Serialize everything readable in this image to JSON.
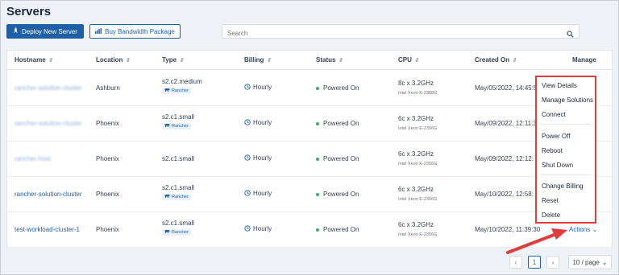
{
  "page": {
    "title": "Servers"
  },
  "toolbar": {
    "deploy_label": "Deploy New Server",
    "bandwidth_label": "Buy Bandwidth Package",
    "search_placeholder": "Search"
  },
  "columns": {
    "hostname": "Hostname",
    "location": "Location",
    "type": "Type",
    "billing": "Billing",
    "status": "Status",
    "cpu": "CPU",
    "created": "Created On",
    "manage": "Manage"
  },
  "rows": [
    {
      "hostname": "rancher-solution-cluster",
      "hostname_blurred": true,
      "location": "Ashburn",
      "type": "s2.c2.medium",
      "tag": "Rancher",
      "billing": "Hourly",
      "status": "Powered On",
      "cpu": "8c x 3.2GHz",
      "cpu_sub": "Intel Xeon E-2388G",
      "created": "May/05/2022, 14:45:5"
    },
    {
      "hostname": "rancher-solution-cluster",
      "hostname_blurred": true,
      "location": "Phoenix",
      "type": "s2.c1.small",
      "tag": "Rancher",
      "billing": "Hourly",
      "status": "Powered On",
      "cpu": "6c x 3.2GHz",
      "cpu_sub": "Intel Xeon E-2356G",
      "created": "May/09/2022, 12:11:3"
    },
    {
      "hostname": "rancher-host",
      "hostname_blurred": true,
      "location": "Phoenix",
      "type": "s2.c1.small",
      "tag": "",
      "billing": "Hourly",
      "status": "Powered On",
      "cpu": "6c x 3.2GHz",
      "cpu_sub": "Intel Xeon E-2356G",
      "created": "May/09/2022, 12:12:"
    },
    {
      "hostname": "rancher-solution-cluster",
      "hostname_blurred": false,
      "location": "Phoenix",
      "type": "s2.c1.small",
      "tag": "Rancher",
      "billing": "Hourly",
      "status": "Powered On",
      "cpu": "6c x 3.2GHz",
      "cpu_sub": "Intel Xeon E-2356G",
      "created": "May/10/2022, 12:58:"
    },
    {
      "hostname": "test-workload-cluster-1",
      "hostname_blurred": false,
      "location": "Phoenix",
      "type": "s2.c1.small",
      "tag": "Rancher",
      "billing": "Hourly",
      "status": "Powered On",
      "cpu": "6c x 3.2GHz",
      "cpu_sub": "Intel Xeon E-2356G",
      "created": "May/10/2022, 11:39:30"
    }
  ],
  "menu": {
    "items": [
      "View Details",
      "Manage Solutions",
      "Connect",
      "Power Off",
      "Reboot",
      "Shut Down",
      "Change Billing",
      "Reset",
      "Delete"
    ]
  },
  "actions_label": "Actions",
  "pagination": {
    "current": "1",
    "per_page": "10 / page"
  },
  "colors": {
    "primary": "#1f5fa6",
    "highlight": "#e23b3b",
    "status_on": "#3db15b"
  },
  "icons": [
    "rocket-icon",
    "bar-chart-icon",
    "search-icon",
    "sort-icon",
    "rancher-icon",
    "clock-icon",
    "status-dot-icon",
    "chevron-down-icon",
    "chevron-left-icon",
    "chevron-right-icon",
    "arrow-annotation-icon"
  ]
}
